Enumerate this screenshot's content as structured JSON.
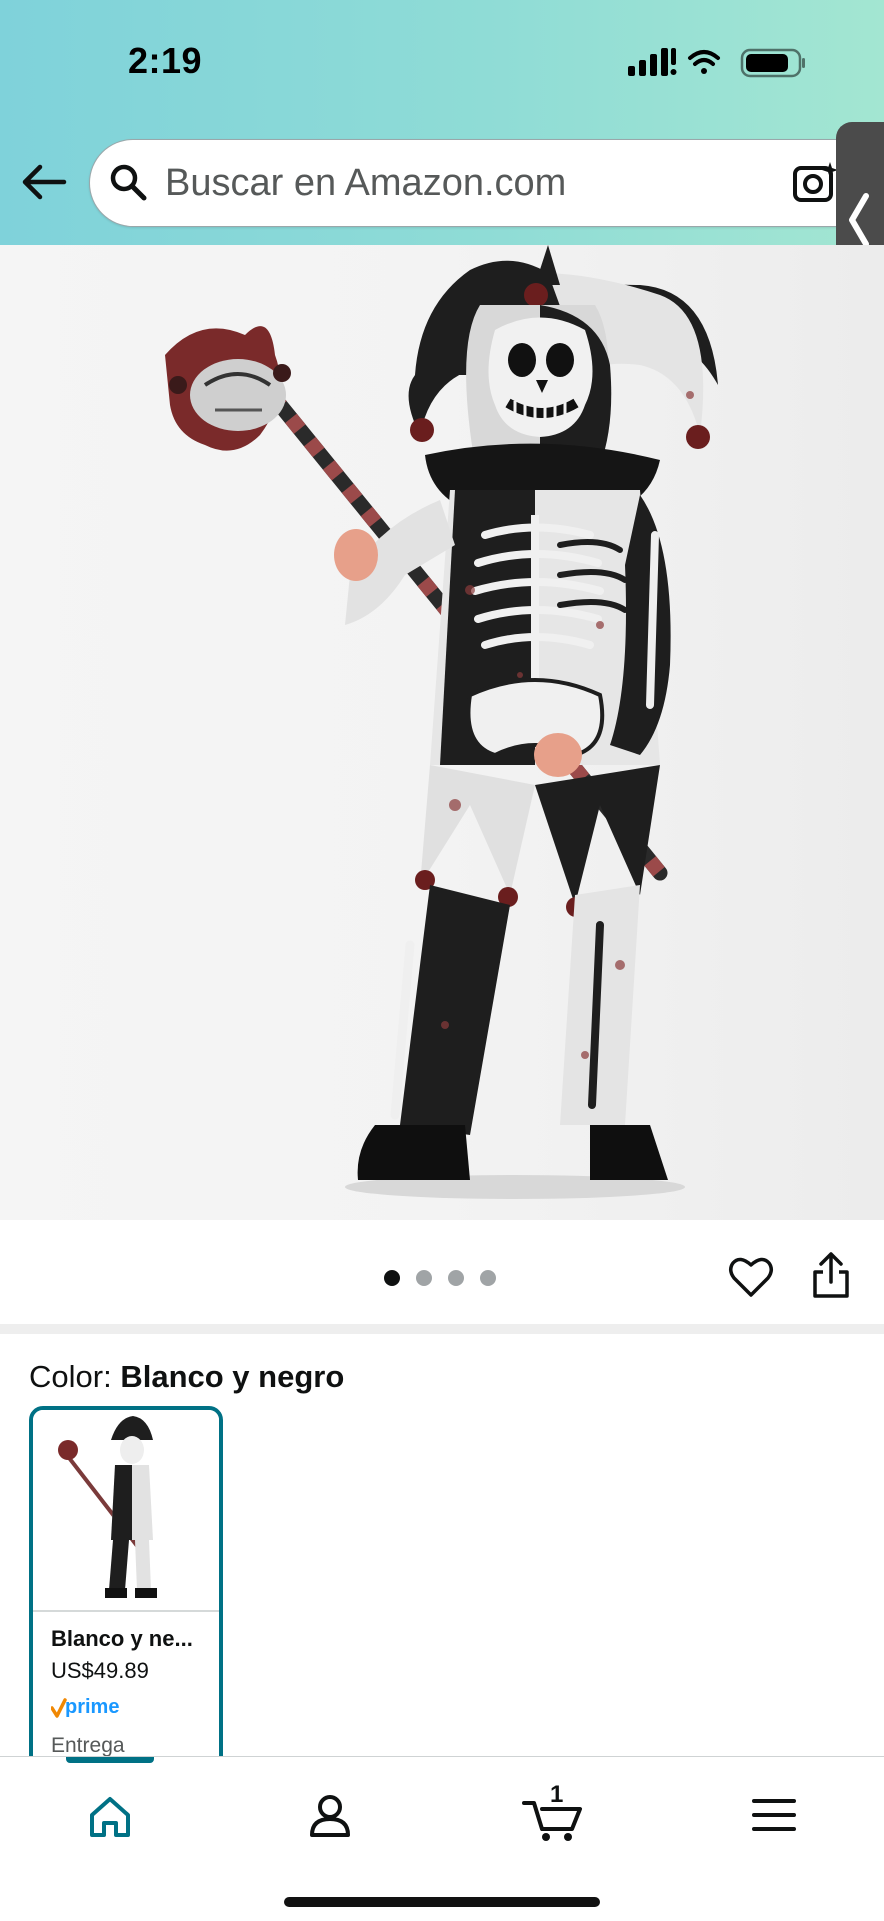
{
  "status_bar": {
    "time": "2:19"
  },
  "search": {
    "placeholder": "Buscar en Amazon.com"
  },
  "carousel": {
    "total_images": 4,
    "active_index": 0
  },
  "color": {
    "label": "Color:",
    "value": "Blanco y negro"
  },
  "swatch": {
    "name": "Blanco y ne...",
    "price": "US$49.89",
    "badge": "prime",
    "delivery": "Entrega"
  },
  "bottom_nav": {
    "items": [
      "home-icon",
      "account-icon",
      "cart-icon",
      "menu-icon"
    ],
    "active": "home",
    "cart_count": "1"
  },
  "colors": {
    "accent": "#007185",
    "header_start": "#7fd2da",
    "header_end": "#a3e6d2",
    "prime_blue": "#1a98ff",
    "prime_check": "#f08804"
  }
}
